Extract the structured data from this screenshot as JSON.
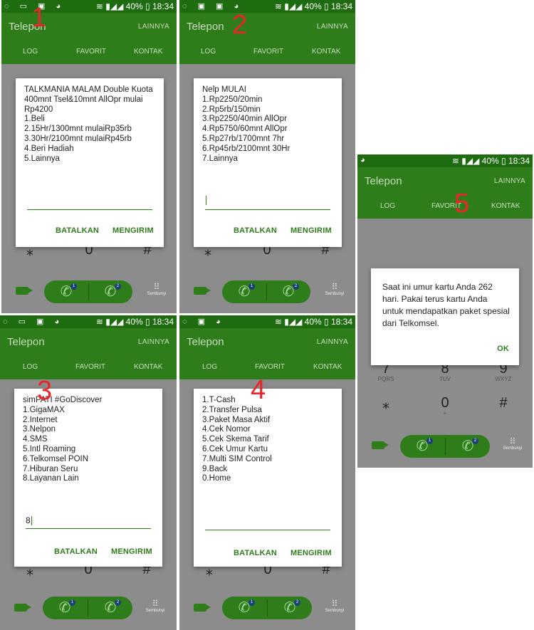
{
  "status": {
    "battery": "40%",
    "time": "18:34"
  },
  "app": {
    "title": "Telepon",
    "more": "LAINNYA"
  },
  "tabs": [
    "LOG",
    "FAVORIT",
    "KONTAK"
  ],
  "dialer": {
    "star": "⁎",
    "zero": "0",
    "plus": "+",
    "hash": "#",
    "dialpad_label": "Sembunyi",
    "sim1": "1",
    "sim2": "2"
  },
  "keypad5": [
    {
      "digit": "7",
      "letters": "PQRS"
    },
    {
      "digit": "8",
      "letters": "TUV"
    },
    {
      "digit": "9",
      "letters": "WXYZ"
    }
  ],
  "panels": [
    {
      "label": "1",
      "message": "TALKMANIA MALAM Double Kuota 400mnt Tsel&10mnt AllOpr mulai Rp4200\n1.Beli\n2.15Hr/1300mnt mulaiRp35rb\n3.30Hr/2100mnt mulaiRp45rb\n4.Beri Hadiah\n5.Lainnya",
      "input": "",
      "cancel": "BATALKAN",
      "send": "MENGIRIM"
    },
    {
      "label": "2",
      "message": "Nelp MULAI\n1.Rp2250/20min\n2.Rp5rb/150min\n3.Rp2250/40min AllOpr\n4.Rp5750/60mnt AllOpr\n5.Rp27rb/1700mnt 7hr\n6.Rp45rb/2100mnt 30Hr\n7.Lainnya",
      "input": "",
      "cancel": "BATALKAN",
      "send": "MENGIRIM"
    },
    {
      "label": "3",
      "message": "simPATI #GoDiscover\n1.GigaMAX\n2.Internet\n3.Nelpon\n4.SMS\n5.Intl Roaming\n6.Telkomsel POIN\n7.Hiburan Seru\n8.Layanan Lain",
      "input": "8",
      "cancel": "BATALKAN",
      "send": "MENGIRIM"
    },
    {
      "label": "4",
      "message": "1.T-Cash\n2.Transfer Pulsa\n3.Paket Masa Aktif\n4.Cek Nomor\n5.Cek Skema Tarif\n6.Cek Umur Kartu\n7.Multi SIM Control\n9.Back\n0.Home",
      "input": "",
      "cancel": "BATALKAN",
      "send": "MENGIRIM"
    },
    {
      "label": "5",
      "message": "Saat ini umur kartu Anda 262 hari. Pakai terus kartu Anda untuk mendapatkan paket spesial dari Telkomsel.",
      "ok": "OK"
    }
  ]
}
